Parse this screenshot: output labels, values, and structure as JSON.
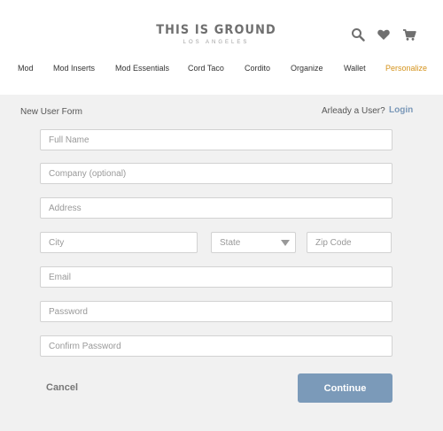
{
  "brand": {
    "name": "THIS IS GROUND",
    "tagline": "LOS ANGELES"
  },
  "header_icons": [
    "search-icon",
    "heart-icon",
    "cart-icon"
  ],
  "nav": [
    "Mod",
    "Mod Inserts",
    "Mod Essentials",
    "Cord Taco",
    "Cordito",
    "Organize",
    "Wallet",
    "Personalize"
  ],
  "form": {
    "title": "New User Form",
    "already_text": "Arleady a User?",
    "login_label": "Login",
    "placeholders": {
      "full_name": "Full Name",
      "company": "Company (optional)",
      "address": "Address",
      "city": "City",
      "state": "State",
      "zip": "Zip Code",
      "email": "Email",
      "password": "Password",
      "confirm_password": "Confirm Password"
    },
    "cancel_label": "Cancel",
    "continue_label": "Continue"
  },
  "colors": {
    "accent": "#d4921a",
    "primary_button": "#7b9ab9",
    "link": "#7a98b8",
    "panel_bg": "#f1f1f1"
  }
}
